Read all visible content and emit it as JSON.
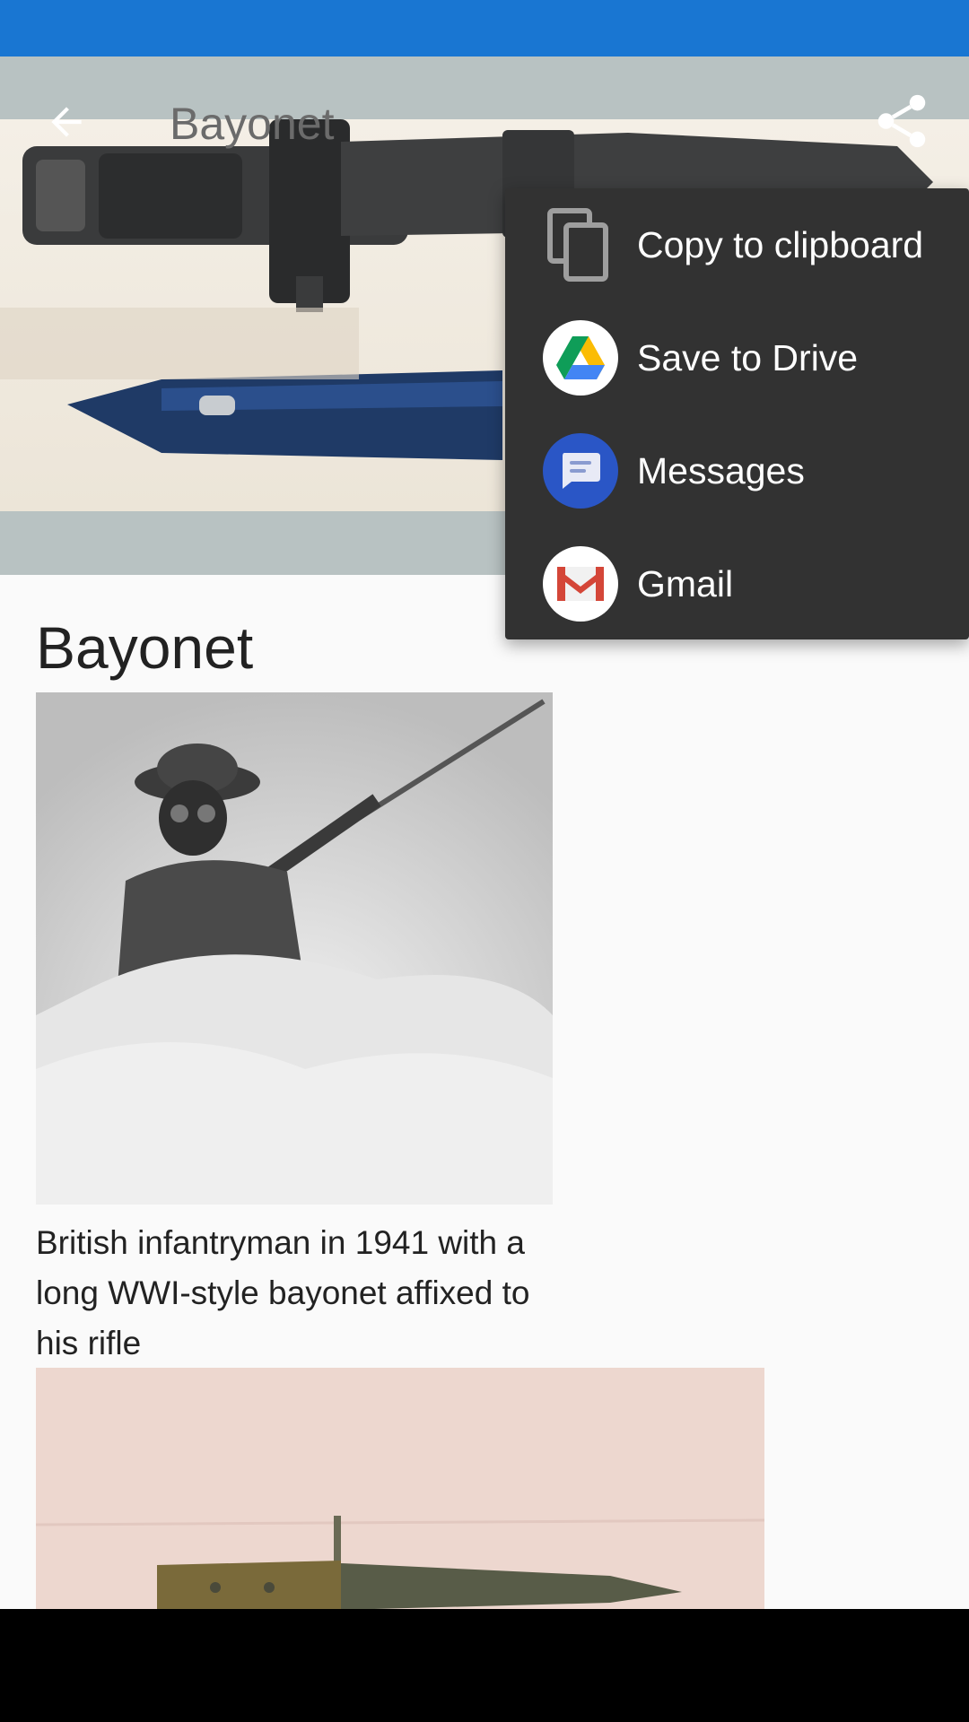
{
  "app_bar": {
    "title": "Bayonet"
  },
  "article": {
    "title": "Bayonet",
    "figure1_caption": "British infantryman in 1941 with a long WWI-style bayonet affixed to his rifle"
  },
  "share_menu": {
    "items": [
      {
        "label": "Copy to clipboard",
        "icon": "copy-icon"
      },
      {
        "label": "Save to Drive",
        "icon": "google-drive-icon"
      },
      {
        "label": "Messages",
        "icon": "messages-icon"
      },
      {
        "label": "Gmail",
        "icon": "gmail-icon"
      }
    ]
  },
  "colors": {
    "status_bar": "#1976d2",
    "menu_bg": "#323232",
    "hero_bg": "#b8c2c2"
  }
}
